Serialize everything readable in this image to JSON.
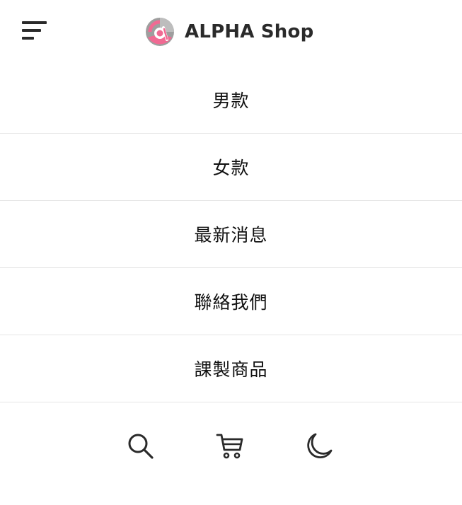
{
  "header": {
    "brand_name": "ALPHA Shop",
    "menu_icon": "menu-icon",
    "logo_icon": "alpha-logo"
  },
  "nav": {
    "items": [
      {
        "label": "男款"
      },
      {
        "label": "女款"
      },
      {
        "label": "最新消息"
      },
      {
        "label": "聯絡我們"
      },
      {
        "label": "課製商品"
      }
    ]
  },
  "actions": {
    "icons": [
      "search-icon",
      "cart-icon",
      "moon-icon"
    ]
  },
  "colors": {
    "logo_pink": "#f06a93",
    "logo_gray": "#9e9e9e",
    "text_dark": "#2a2a2a",
    "divider": "#e6e6e6"
  }
}
